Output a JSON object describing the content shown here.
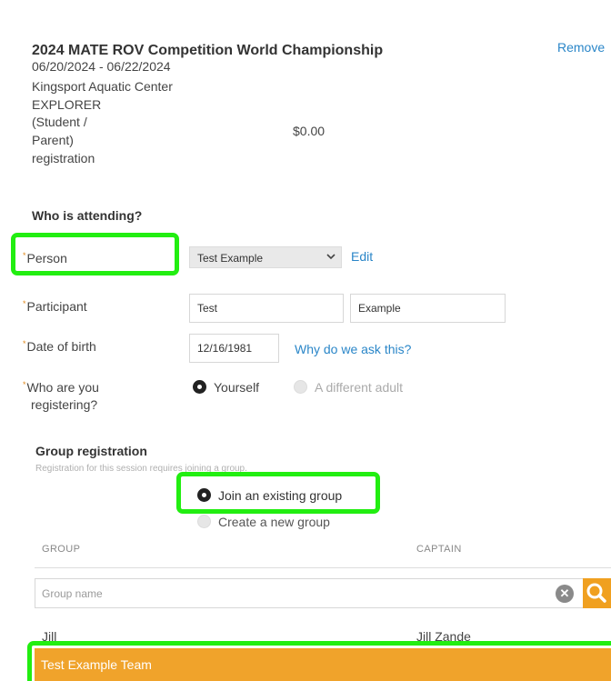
{
  "event": {
    "title": "2024 MATE ROV Competition World Championship",
    "remove_label": "Remove",
    "dates": "06/20/2024 - 06/22/2024",
    "venue": "Kingsport Aquatic Center",
    "category_lines": [
      "EXPLORER",
      "(Student /",
      "Parent)",
      "registration"
    ],
    "price": "$0.00"
  },
  "attendee": {
    "section_title": "Who is attending?",
    "required_mark": "*",
    "person_label": "Person",
    "person_value": "Test Example",
    "edit_label": "Edit",
    "participant_label": "Participant",
    "first_name": "Test",
    "last_name": "Example",
    "dob_label": "Date of birth",
    "dob_value": "12/16/1981",
    "why_label": "Why do we ask this?",
    "registering_label_lines": [
      "Who are you",
      "registering?"
    ],
    "option_yourself": "Yourself",
    "option_other": "A different adult",
    "selected_option": "Yourself"
  },
  "group": {
    "title": "Group registration",
    "subtitle": "Registration for this session requires joining a group.",
    "option_join": "Join an existing group",
    "option_create": "Create a new group",
    "selected_option": "Join an existing group",
    "col_group": "GROUP",
    "col_captain": "CAPTAIN",
    "search_placeholder": "Group name",
    "rows": [
      {
        "group": "Jill",
        "captain": "Jill Zande"
      },
      {
        "group": "Test Example Team",
        "captain": ""
      }
    ],
    "selected_row": "Test Example Team"
  },
  "colors": {
    "link": "#2a86c8",
    "accent_orange": "#f0a32b",
    "highlight_green": "#22ee11"
  },
  "icons": [
    "chevron-down-icon",
    "clear-icon",
    "search-icon"
  ]
}
